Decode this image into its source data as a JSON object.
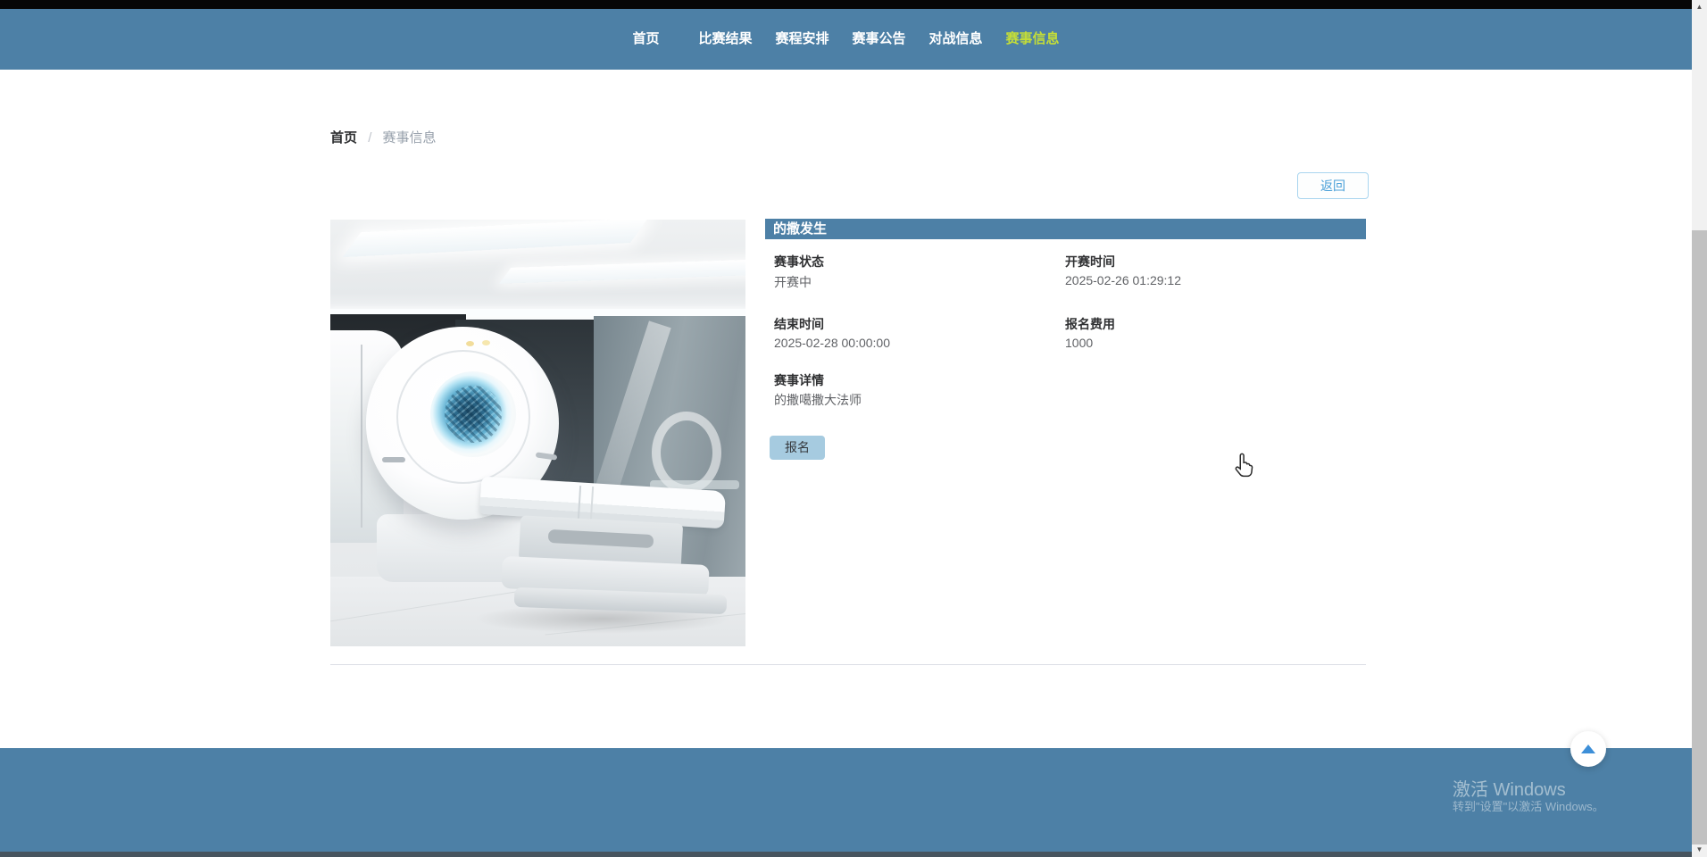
{
  "nav": {
    "items": [
      {
        "label": "首页",
        "active": false
      },
      {
        "label": "比赛结果",
        "active": false
      },
      {
        "label": "赛程安排",
        "active": false
      },
      {
        "label": "赛事公告",
        "active": false
      },
      {
        "label": "对战信息",
        "active": false
      },
      {
        "label": "赛事信息",
        "active": true
      }
    ]
  },
  "breadcrumb": {
    "home": "首页",
    "separator": "/",
    "current": "赛事信息"
  },
  "toolbar": {
    "back_label": "返回"
  },
  "event": {
    "title": "的撒发生",
    "status_label": "赛事状态",
    "status_value": "开赛中",
    "start_label": "开赛时间",
    "start_value": "2025-02-26 01:29:12",
    "end_label": "结束时间",
    "end_value": "2025-02-28 00:00:00",
    "fee_label": "报名费用",
    "fee_value": "1000",
    "detail_label": "赛事详情",
    "detail_value": "的撒噶撒大法师",
    "register_label": "报名"
  },
  "image": {
    "name": "mri-scanner-photo"
  },
  "watermark": {
    "line1": "激活 Windows",
    "line2": "转到\"设置\"以激活 Windows。"
  },
  "colors": {
    "primary_blue": "#4d80a6",
    "active_link": "#c4dd38",
    "link_blue": "#4aa0d8",
    "register_bg": "#a6cbe0"
  }
}
